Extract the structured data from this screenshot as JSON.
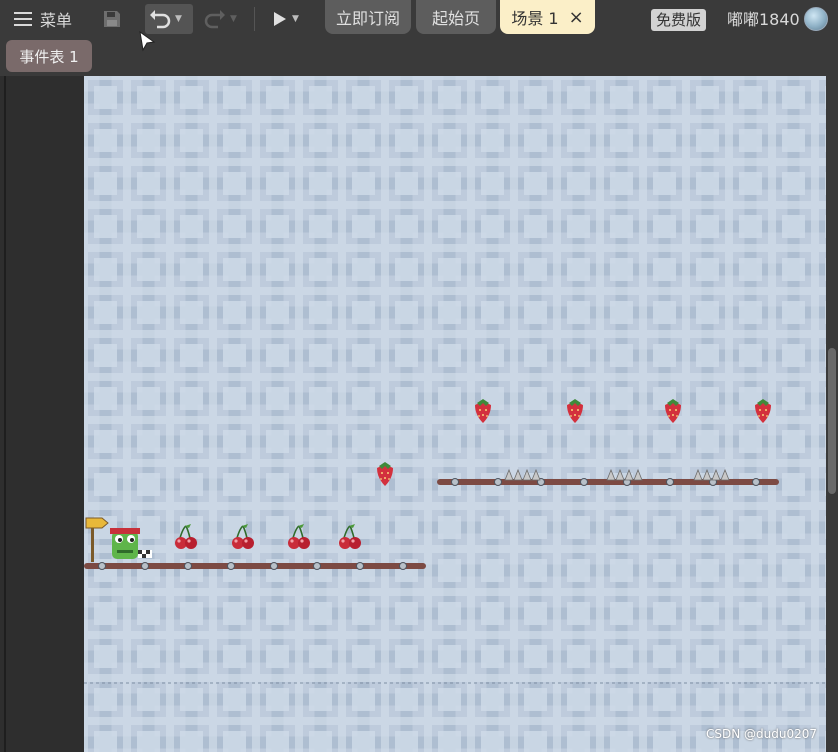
{
  "toolbar": {
    "menu_label": "菜单",
    "tabs": [
      {
        "label": "立即订阅"
      },
      {
        "label": "起始页"
      },
      {
        "label": "场景 1",
        "close": "×"
      }
    ],
    "free_badge": "免费版",
    "username": "嘟嘟1840"
  },
  "event_tab": {
    "label": "事件表 1"
  },
  "scene": {
    "colors": {
      "tile_bg": "#c6d3e1",
      "tile_dark": "#aebed1",
      "tile_light": "#cad7e6",
      "platform": "#7c4a43",
      "spike": "#c8c8c8",
      "cherry": "#c92c3a",
      "strawberry": "#d3303d"
    },
    "cherries": 4,
    "strawberries": 5,
    "spike_groups": 3
  },
  "watermark": "CSDN @dudu0207"
}
